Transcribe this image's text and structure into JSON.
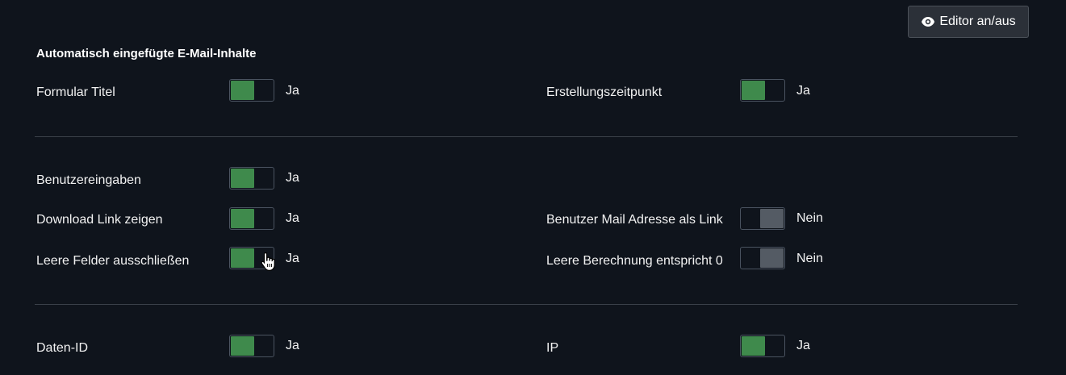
{
  "toolbar": {
    "editor_toggle_label": "Editor an/aus"
  },
  "section": {
    "title": "Automatisch eingefügte E-Mail-Inhalte"
  },
  "fields": {
    "formular_titel": {
      "label": "Formular Titel",
      "state": "Ja",
      "on": true
    },
    "erstellungszeitpunkt": {
      "label": "Erstellungszeitpunkt",
      "state": "Ja",
      "on": true
    },
    "benutzereingaben": {
      "label": "Benutzereingaben",
      "state": "Ja",
      "on": true
    },
    "download_link": {
      "label": "Download Link zeigen",
      "state": "Ja",
      "on": true
    },
    "mail_link": {
      "label": "Benutzer Mail Adresse als Link",
      "state": "Nein",
      "on": false
    },
    "leere_felder": {
      "label": "Leere Felder ausschließen",
      "state": "Ja",
      "on": true
    },
    "leere_berechnung": {
      "label": "Leere Berechnung entspricht 0",
      "state": "Nein",
      "on": false
    },
    "daten_id": {
      "label": "Daten-ID",
      "state": "Ja",
      "on": true
    },
    "ip": {
      "label": "IP",
      "state": "Ja",
      "on": true
    }
  },
  "colors": {
    "background": "#0f141c",
    "toggle_on": "#3f8a4c",
    "toggle_off": "#545b64",
    "button_bg": "#2b3038"
  }
}
